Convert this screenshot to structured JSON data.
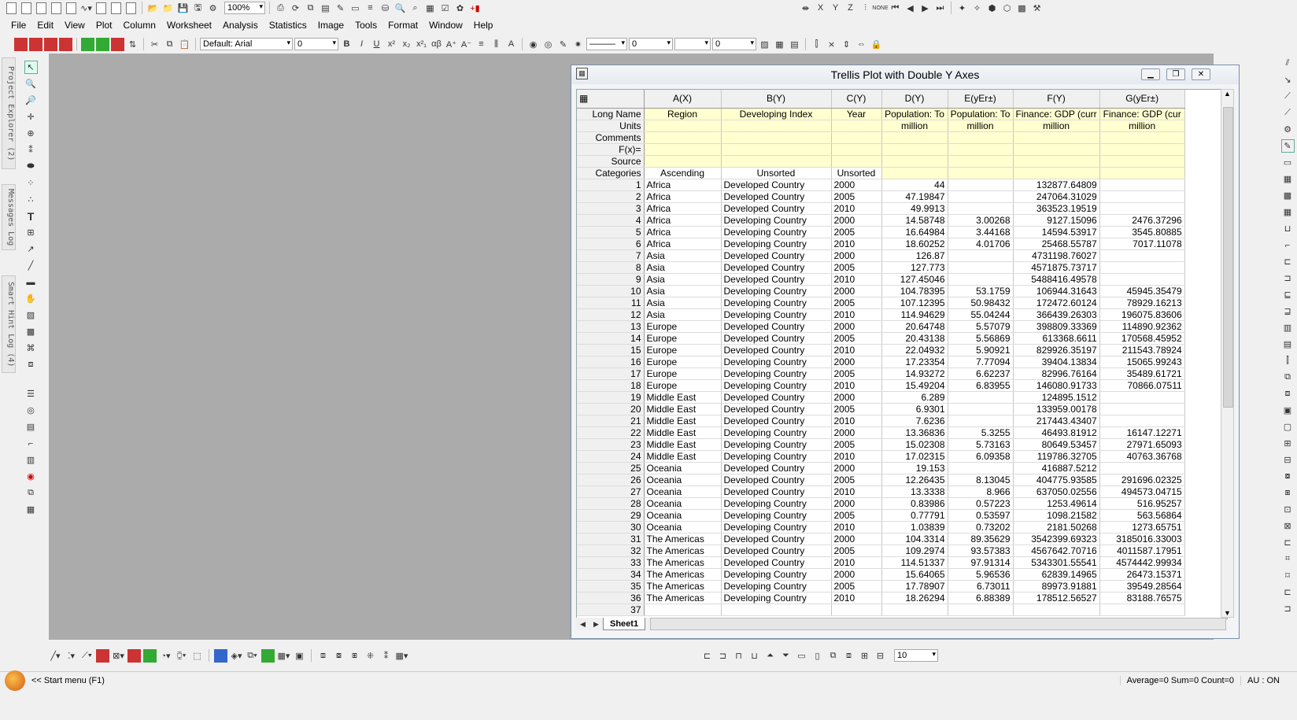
{
  "toolbar": {
    "zoom": "100%",
    "font": "Default: Arial",
    "font_size": "0",
    "line_width": "0",
    "size2": "0",
    "size3": "10"
  },
  "menu": [
    "File",
    "Edit",
    "View",
    "Plot",
    "Column",
    "Worksheet",
    "Analysis",
    "Statistics",
    "Image",
    "Tools",
    "Format",
    "Window",
    "Help"
  ],
  "side_tabs": [
    "Project Explorer (2)",
    "Messages Log",
    "Smart Hint Log (4)"
  ],
  "window": {
    "title": "Trellis Plot with Double Y Axes",
    "sheet_tab": "Sheet1"
  },
  "columns": [
    {
      "id": "A(X)",
      "long_name": "Region",
      "units": "",
      "category": "Ascending"
    },
    {
      "id": "B(Y)",
      "long_name": "Developing Index",
      "units": "",
      "category": "Unsorted"
    },
    {
      "id": "C(Y)",
      "long_name": "Year",
      "units": "",
      "category": "Unsorted"
    },
    {
      "id": "D(Y)",
      "long_name": "Population: To",
      "units": "million",
      "category": ""
    },
    {
      "id": "E(yEr±)",
      "long_name": "Population: To",
      "units": "million",
      "category": ""
    },
    {
      "id": "F(Y)",
      "long_name": "Finance: GDP (curr",
      "units": "million",
      "category": ""
    },
    {
      "id": "G(yEr±)",
      "long_name": "Finance: GDP (cur",
      "units": "million",
      "category": ""
    }
  ],
  "meta_labels": [
    "Long Name",
    "Units",
    "Comments",
    "F(x)=",
    "Source",
    "Categories"
  ],
  "rows": [
    [
      "1",
      "Africa",
      "Developed Country",
      "2000",
      "44",
      "",
      "132877.64809",
      ""
    ],
    [
      "2",
      "Africa",
      "Developed Country",
      "2005",
      "47.19847",
      "",
      "247064.31029",
      ""
    ],
    [
      "3",
      "Africa",
      "Developed Country",
      "2010",
      "49.9913",
      "",
      "363523.19519",
      ""
    ],
    [
      "4",
      "Africa",
      "Developing Country",
      "2000",
      "14.58748",
      "3.00268",
      "9127.15096",
      "2476.37296"
    ],
    [
      "5",
      "Africa",
      "Developing Country",
      "2005",
      "16.64984",
      "3.44168",
      "14594.53917",
      "3545.80885"
    ],
    [
      "6",
      "Africa",
      "Developing Country",
      "2010",
      "18.60252",
      "4.01706",
      "25468.55787",
      "7017.11078"
    ],
    [
      "7",
      "Asia",
      "Developed Country",
      "2000",
      "126.87",
      "",
      "4731198.76027",
      ""
    ],
    [
      "8",
      "Asia",
      "Developed Country",
      "2005",
      "127.773",
      "",
      "4571875.73717",
      ""
    ],
    [
      "9",
      "Asia",
      "Developed Country",
      "2010",
      "127.45046",
      "",
      "5488416.49578",
      ""
    ],
    [
      "10",
      "Asia",
      "Developing Country",
      "2000",
      "104.78395",
      "53.1759",
      "106944.31643",
      "45945.35479"
    ],
    [
      "11",
      "Asia",
      "Developing Country",
      "2005",
      "107.12395",
      "50.98432",
      "172472.60124",
      "78929.16213"
    ],
    [
      "12",
      "Asia",
      "Developing Country",
      "2010",
      "114.94629",
      "55.04244",
      "366439.26303",
      "196075.83606"
    ],
    [
      "13",
      "Europe",
      "Developed Country",
      "2000",
      "20.64748",
      "5.57079",
      "398809.33369",
      "114890.92362"
    ],
    [
      "14",
      "Europe",
      "Developed Country",
      "2005",
      "20.43138",
      "5.56869",
      "613368.6611",
      "170568.45952"
    ],
    [
      "15",
      "Europe",
      "Developed Country",
      "2010",
      "22.04932",
      "5.90921",
      "829926.35197",
      "211543.78924"
    ],
    [
      "16",
      "Europe",
      "Developing Country",
      "2000",
      "17.23354",
      "7.77094",
      "39404.13834",
      "15065.99243"
    ],
    [
      "17",
      "Europe",
      "Developing Country",
      "2005",
      "14.93272",
      "6.62237",
      "82996.76164",
      "35489.61721"
    ],
    [
      "18",
      "Europe",
      "Developing Country",
      "2010",
      "15.49204",
      "6.83955",
      "146080.91733",
      "70866.07511"
    ],
    [
      "19",
      "Middle East",
      "Developed Country",
      "2000",
      "6.289",
      "",
      "124895.1512",
      ""
    ],
    [
      "20",
      "Middle East",
      "Developed Country",
      "2005",
      "6.9301",
      "",
      "133959.00178",
      ""
    ],
    [
      "21",
      "Middle East",
      "Developed Country",
      "2010",
      "7.6236",
      "",
      "217443.43407",
      ""
    ],
    [
      "22",
      "Middle East",
      "Developing Country",
      "2000",
      "13.36836",
      "5.3255",
      "46493.81912",
      "16147.12271"
    ],
    [
      "23",
      "Middle East",
      "Developing Country",
      "2005",
      "15.02308",
      "5.73163",
      "80649.53457",
      "27971.65093"
    ],
    [
      "24",
      "Middle East",
      "Developing Country",
      "2010",
      "17.02315",
      "6.09358",
      "119786.32705",
      "40763.36768"
    ],
    [
      "25",
      "Oceania",
      "Developed Country",
      "2000",
      "19.153",
      "",
      "416887.5212",
      ""
    ],
    [
      "26",
      "Oceania",
      "Developed Country",
      "2005",
      "12.26435",
      "8.13045",
      "404775.93585",
      "291696.02325"
    ],
    [
      "27",
      "Oceania",
      "Developed Country",
      "2010",
      "13.3338",
      "8.966",
      "637050.02556",
      "494573.04715"
    ],
    [
      "28",
      "Oceania",
      "Developing Country",
      "2000",
      "0.83986",
      "0.57223",
      "1253.49614",
      "516.95257"
    ],
    [
      "29",
      "Oceania",
      "Developing Country",
      "2005",
      "0.77791",
      "0.53597",
      "1098.21582",
      "563.56864"
    ],
    [
      "30",
      "Oceania",
      "Developing Country",
      "2010",
      "1.03839",
      "0.73202",
      "2181.50268",
      "1273.65751"
    ],
    [
      "31",
      "The Americas",
      "Developed Country",
      "2000",
      "104.3314",
      "89.35629",
      "3542399.69323",
      "3185016.33003"
    ],
    [
      "32",
      "The Americas",
      "Developed Country",
      "2005",
      "109.2974",
      "93.57383",
      "4567642.70716",
      "4011587.17951"
    ],
    [
      "33",
      "The Americas",
      "Developed Country",
      "2010",
      "114.51337",
      "97.91314",
      "5343301.55541",
      "4574442.99934"
    ],
    [
      "34",
      "The Americas",
      "Developing Country",
      "2000",
      "15.64065",
      "5.96536",
      "62839.14965",
      "26473.15371"
    ],
    [
      "35",
      "The Americas",
      "Developing Country",
      "2005",
      "17.78907",
      "6.73011",
      "89973.91881",
      "39549.28564"
    ],
    [
      "36",
      "The Americas",
      "Developing Country",
      "2010",
      "18.26294",
      "6.88389",
      "178512.56527",
      "83188.76575"
    ],
    [
      "37",
      "",
      "",
      "",
      "",
      "",
      "",
      ""
    ]
  ],
  "status": {
    "start": "<< Start menu (F1)",
    "stats": "Average=0 Sum=0 Count=0",
    "au": "AU : ON"
  }
}
